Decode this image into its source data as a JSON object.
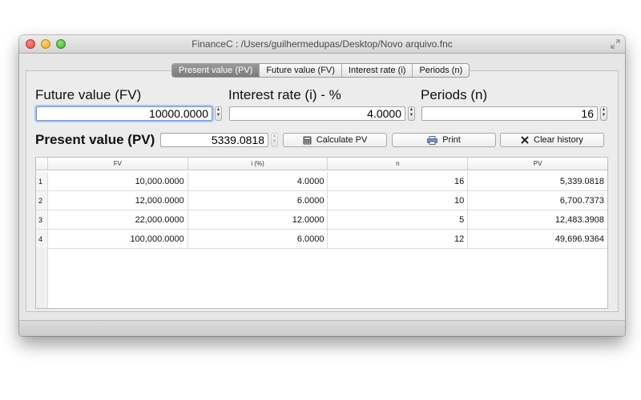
{
  "window": {
    "title": "FinanceC : /Users/guilhermedupas/Desktop/Novo arquivo.fnc"
  },
  "tabs": [
    {
      "label": "Present value (PV)",
      "active": true
    },
    {
      "label": "Future value (FV)",
      "active": false
    },
    {
      "label": "Interest rate (i)",
      "active": false
    },
    {
      "label": "Periods (n)",
      "active": false
    }
  ],
  "inputs": {
    "fv": {
      "label": "Future value (FV)",
      "value": "10000.0000"
    },
    "rate": {
      "label": "Interest rate (i) - %",
      "value": "4.0000"
    },
    "periods": {
      "label": "Periods (n)",
      "value": "16"
    }
  },
  "result": {
    "label": "Present value (PV)",
    "value": "5339.0818"
  },
  "buttons": {
    "calculate": "Calculate PV",
    "print": "Print",
    "clear": "Clear history"
  },
  "table": {
    "columns": [
      "FV",
      "i (%)",
      "n",
      "PV"
    ],
    "rows": [
      {
        "num": "1",
        "fv": "10,000.0000",
        "i": "4.0000",
        "n": "16",
        "pv": "5,339.0818"
      },
      {
        "num": "2",
        "fv": "12,000.0000",
        "i": "6.0000",
        "n": "10",
        "pv": "6,700.7373"
      },
      {
        "num": "3",
        "fv": "22,000.0000",
        "i": "12.0000",
        "n": "5",
        "pv": "12,483.3908"
      },
      {
        "num": "4",
        "fv": "100,000.0000",
        "i": "6.0000",
        "n": "12",
        "pv": "49,696.9364"
      }
    ]
  },
  "icons": {
    "calculate": "calculator-icon",
    "print": "printer-icon",
    "clear": "x-icon"
  }
}
